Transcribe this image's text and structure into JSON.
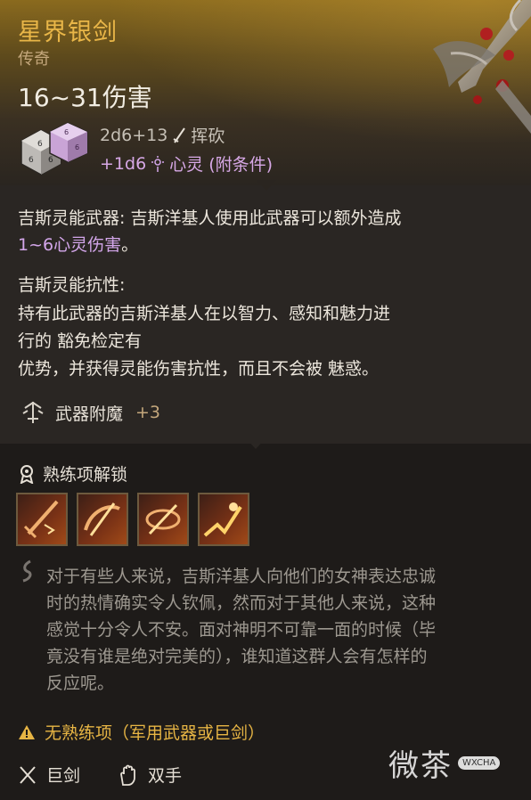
{
  "item": {
    "name": "星界银剑",
    "rarity": "传奇",
    "damage": "16~31伤害",
    "damage_dice": "2d6+13",
    "damage_type": "挥砍",
    "extra_dice": "+1d6",
    "extra_type": "心灵 (附条件)"
  },
  "traits": {
    "psionic_weapon_label": "吉斯灵能武器:",
    "psionic_weapon_text": " 吉斯洋基人使用此武器可以额外造成",
    "psionic_weapon_damage": "1~6心灵伤害",
    "psionic_weapon_end": "。",
    "psionic_res_title": "吉斯灵能抗性:",
    "psionic_res_line1": "持有此武器的吉斯洋基人在以智力、感知和魅力进",
    "psionic_res_line2": "行的 豁免检定有",
    "psionic_res_line3": "优势，并获得灵能伤害抗性，而且不会被 魅惑。"
  },
  "enchant": {
    "label": "武器附魔",
    "value": "+3"
  },
  "proficiency": {
    "title": "熟练项解锁",
    "skills": [
      "skill-1",
      "skill-2",
      "skill-3",
      "skill-4"
    ]
  },
  "flavor": {
    "lines": [
      "对于有些人来说，吉斯洋基人向他们的女神表达忠诚",
      "时的热情确实令人钦佩，然而对于其他人来说，这种",
      "感觉十分令人不安。面对神明不可靠一面的时候（毕",
      "竟没有谁是绝对完美的），谁知道这群人会有怎样的",
      "反应呢。"
    ]
  },
  "warning": {
    "text": "无熟练项（军用武器或巨剑）"
  },
  "footer": {
    "weapon_type": "巨剑",
    "handedness": "双手"
  },
  "watermark": {
    "text": "微茶",
    "badge": "WXCHA"
  },
  "colors": {
    "name_gold": "#e9b648",
    "psychic_purple": "#d3a6ea",
    "warning_yellow": "#e7b544"
  }
}
